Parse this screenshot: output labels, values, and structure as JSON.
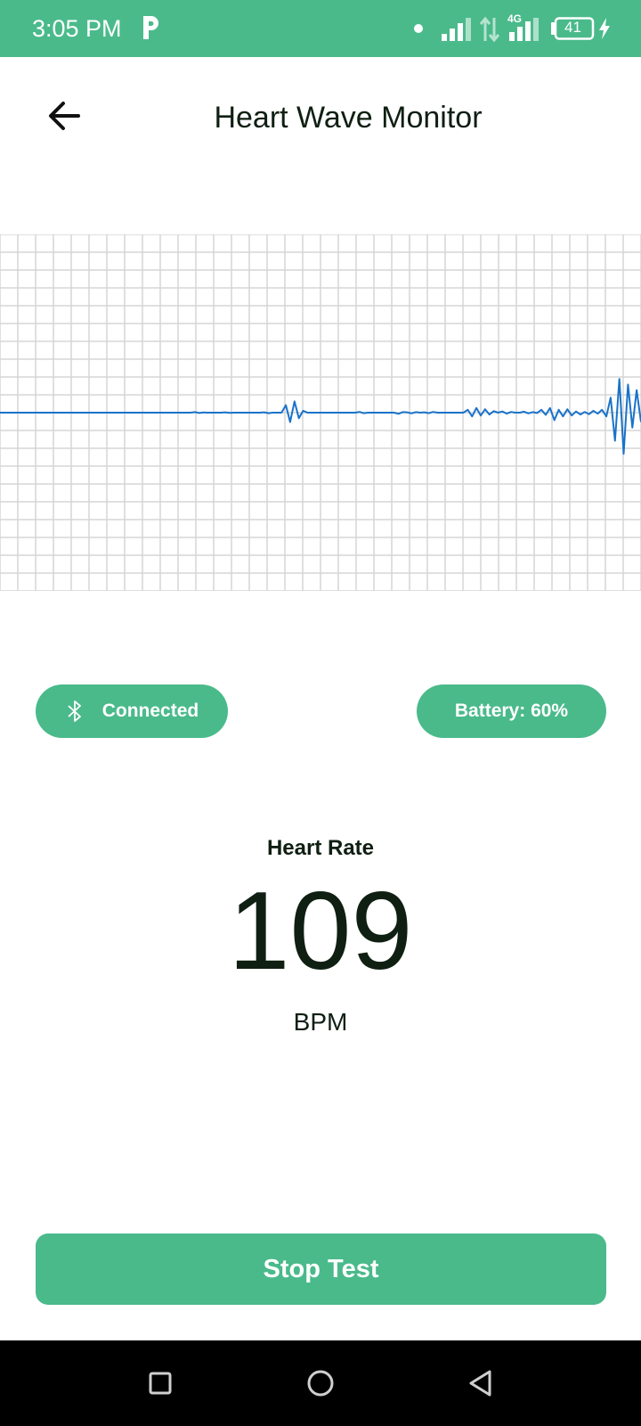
{
  "status_bar": {
    "time": "3:05 PM",
    "battery_level": "41",
    "network_label": "4G",
    "icons": [
      "parking-icon",
      "dot-icon",
      "signal-icon",
      "data-arrows-icon",
      "signal-4g-icon",
      "battery-icon",
      "charging-bolt-icon"
    ]
  },
  "app_bar": {
    "back_icon": "arrow-left-icon",
    "title": "Heart Wave Monitor"
  },
  "chart_data": {
    "type": "line",
    "title": "",
    "xlabel": "",
    "ylabel": "",
    "grid": true,
    "line_color": "#1a73c9",
    "grid_color": "#d6d6d6",
    "series": [
      {
        "values": [
          0,
          0,
          0,
          0,
          0,
          0,
          0,
          0,
          0,
          0,
          0,
          0,
          0,
          0,
          0,
          0,
          0,
          0,
          0,
          0,
          0,
          0,
          0,
          0,
          0,
          0,
          0,
          0,
          0,
          0,
          0,
          0,
          0,
          0,
          0,
          0,
          0,
          0,
          0,
          0,
          0,
          0,
          0,
          0,
          0,
          0.3,
          -0.2,
          0.1,
          0,
          0,
          0,
          0,
          0.2,
          -0.1,
          0,
          0,
          0,
          0,
          0,
          0,
          0,
          0.2,
          -0.3,
          0,
          0,
          0,
          4,
          -5,
          6,
          -3,
          1,
          0,
          0,
          0,
          0,
          0,
          0,
          0,
          0,
          0,
          0,
          0,
          0,
          0.4,
          -0.3,
          0,
          0,
          0,
          0,
          0,
          0,
          0,
          -0.6,
          0.3,
          0.2,
          -0.4,
          0.3,
          0,
          0.2,
          -0.3,
          0.4,
          0,
          0,
          0,
          0,
          0,
          0,
          0,
          1.5,
          -2,
          2.5,
          -1.5,
          1.8,
          -1,
          0.8,
          0,
          0.6,
          -0.5,
          0.4,
          0,
          0,
          0.5,
          -0.4,
          0.3,
          -0.2,
          1.5,
          -1.2,
          2.5,
          -4,
          1.5,
          -2,
          1.8,
          -1.5,
          0.6,
          -1,
          0.4,
          -0.8,
          1,
          -0.5,
          1.5,
          -2,
          8,
          -15,
          18,
          -22,
          15,
          -8,
          12,
          -5
        ]
      }
    ]
  },
  "status_pills": {
    "bluetooth_icon": "bluetooth-icon",
    "connection_label": "Connected",
    "battery_label": "Battery: 60%"
  },
  "heart_rate": {
    "label": "Heart Rate",
    "value": "109",
    "unit": "BPM"
  },
  "actions": {
    "stop_label": "Stop Test"
  },
  "nav_bar": {
    "icons": [
      "square-recents-icon",
      "circle-home-icon",
      "triangle-back-icon"
    ]
  }
}
